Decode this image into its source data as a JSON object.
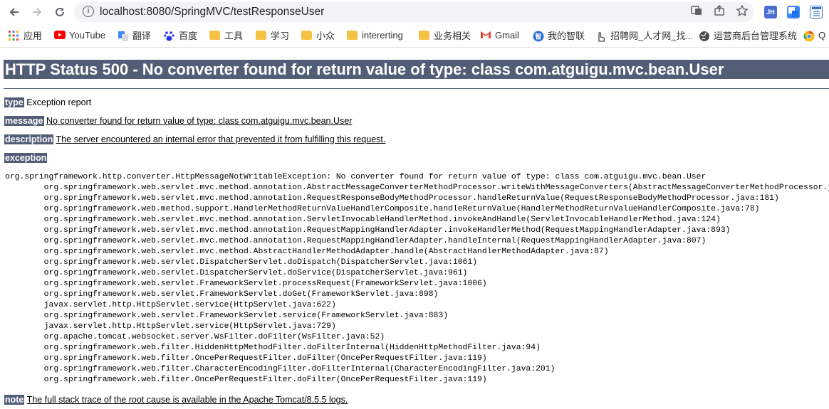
{
  "browser": {
    "url": "localhost:8080/SpringMVC/testResponseUser",
    "bookmarks": [
      {
        "label": "应用",
        "icon": "apps-icon"
      },
      {
        "label": "YouTube",
        "icon": "youtube-icon"
      },
      {
        "label": "翻译",
        "icon": "translate-icon"
      },
      {
        "label": "百度",
        "icon": "baidu-icon"
      },
      {
        "label": "工具",
        "icon": "folder-icon"
      },
      {
        "label": "学习",
        "icon": "folder-icon"
      },
      {
        "label": "小众",
        "icon": "folder-icon"
      },
      {
        "label": "intererting",
        "icon": "folder-icon"
      },
      {
        "label": "业务相关",
        "icon": "folder-icon"
      },
      {
        "label": "Gmail",
        "icon": "gmail-icon"
      },
      {
        "label": "我的智联",
        "icon": "zhilian-icon"
      },
      {
        "label": "招聘网_人才网_找...",
        "icon": "hand-icon"
      },
      {
        "label": "运营商后台管理系统",
        "icon": "globe-icon"
      },
      {
        "label": "Q",
        "icon": "chrome-icon"
      }
    ],
    "extensions": [
      "JH"
    ]
  },
  "page": {
    "title": "HTTP Status 500 - No converter found for return value of type: class com.atguigu.mvc.bean.User",
    "type_label": "type",
    "type_value": "Exception report",
    "message_label": "message",
    "message_value": "No converter found for return value of type: class com.atguigu.mvc.bean.User",
    "description_label": "description",
    "description_value": "The server encountered an internal error that prevented it from fulfilling this request.",
    "exception_label": "exception",
    "exception_lines": [
      "org.springframework.http.converter.HttpMessageNotWritableException: No converter found for return value of type: class com.atguigu.mvc.bean.User",
      "\torg.springframework.web.servlet.mvc.method.annotation.AbstractMessageConverterMethodProcessor.writeWithMessageConverters(AbstractMessageConverterMethodProcessor.java:",
      "\torg.springframework.web.servlet.mvc.method.annotation.RequestResponseBodyMethodProcessor.handleReturnValue(RequestResponseBodyMethodProcessor.java:181)",
      "\torg.springframework.web.method.support.HandlerMethodReturnValueHandlerComposite.handleReturnValue(HandlerMethodReturnValueHandlerComposite.java:78)",
      "\torg.springframework.web.servlet.mvc.method.annotation.ServletInvocableHandlerMethod.invokeAndHandle(ServletInvocableHandlerMethod.java:124)",
      "\torg.springframework.web.servlet.mvc.method.annotation.RequestMappingHandlerAdapter.invokeHandlerMethod(RequestMappingHandlerAdapter.java:893)",
      "\torg.springframework.web.servlet.mvc.method.annotation.RequestMappingHandlerAdapter.handleInternal(RequestMappingHandlerAdapter.java:807)",
      "\torg.springframework.web.servlet.mvc.method.AbstractHandlerMethodAdapter.handle(AbstractHandlerMethodAdapter.java:87)",
      "\torg.springframework.web.servlet.DispatcherServlet.doDispatch(DispatcherServlet.java:1061)",
      "\torg.springframework.web.servlet.DispatcherServlet.doService(DispatcherServlet.java:961)",
      "\torg.springframework.web.servlet.FrameworkServlet.processRequest(FrameworkServlet.java:1006)",
      "\torg.springframework.web.servlet.FrameworkServlet.doGet(FrameworkServlet.java:898)",
      "\tjavax.servlet.http.HttpServlet.service(HttpServlet.java:622)",
      "\torg.springframework.web.servlet.FrameworkServlet.service(FrameworkServlet.java:883)",
      "\tjavax.servlet.http.HttpServlet.service(HttpServlet.java:729)",
      "\torg.apache.tomcat.websocket.server.WsFilter.doFilter(WsFilter.java:52)",
      "\torg.springframework.web.filter.HiddenHttpMethodFilter.doFilterInternal(HiddenHttpMethodFilter.java:94)",
      "\torg.springframework.web.filter.OncePerRequestFilter.doFilter(OncePerRequestFilter.java:119)",
      "\torg.springframework.web.filter.CharacterEncodingFilter.doFilterInternal(CharacterEncodingFilter.java:201)",
      "\torg.springframework.web.filter.OncePerRequestFilter.doFilter(OncePerRequestFilter.java:119)"
    ],
    "note_label": "note",
    "note_value": "The full stack trace of the root cause is available in the Apache Tomcat/8.5.5 logs."
  },
  "colors": {
    "header_bg": "#525d76",
    "folder": "#f6c244"
  }
}
